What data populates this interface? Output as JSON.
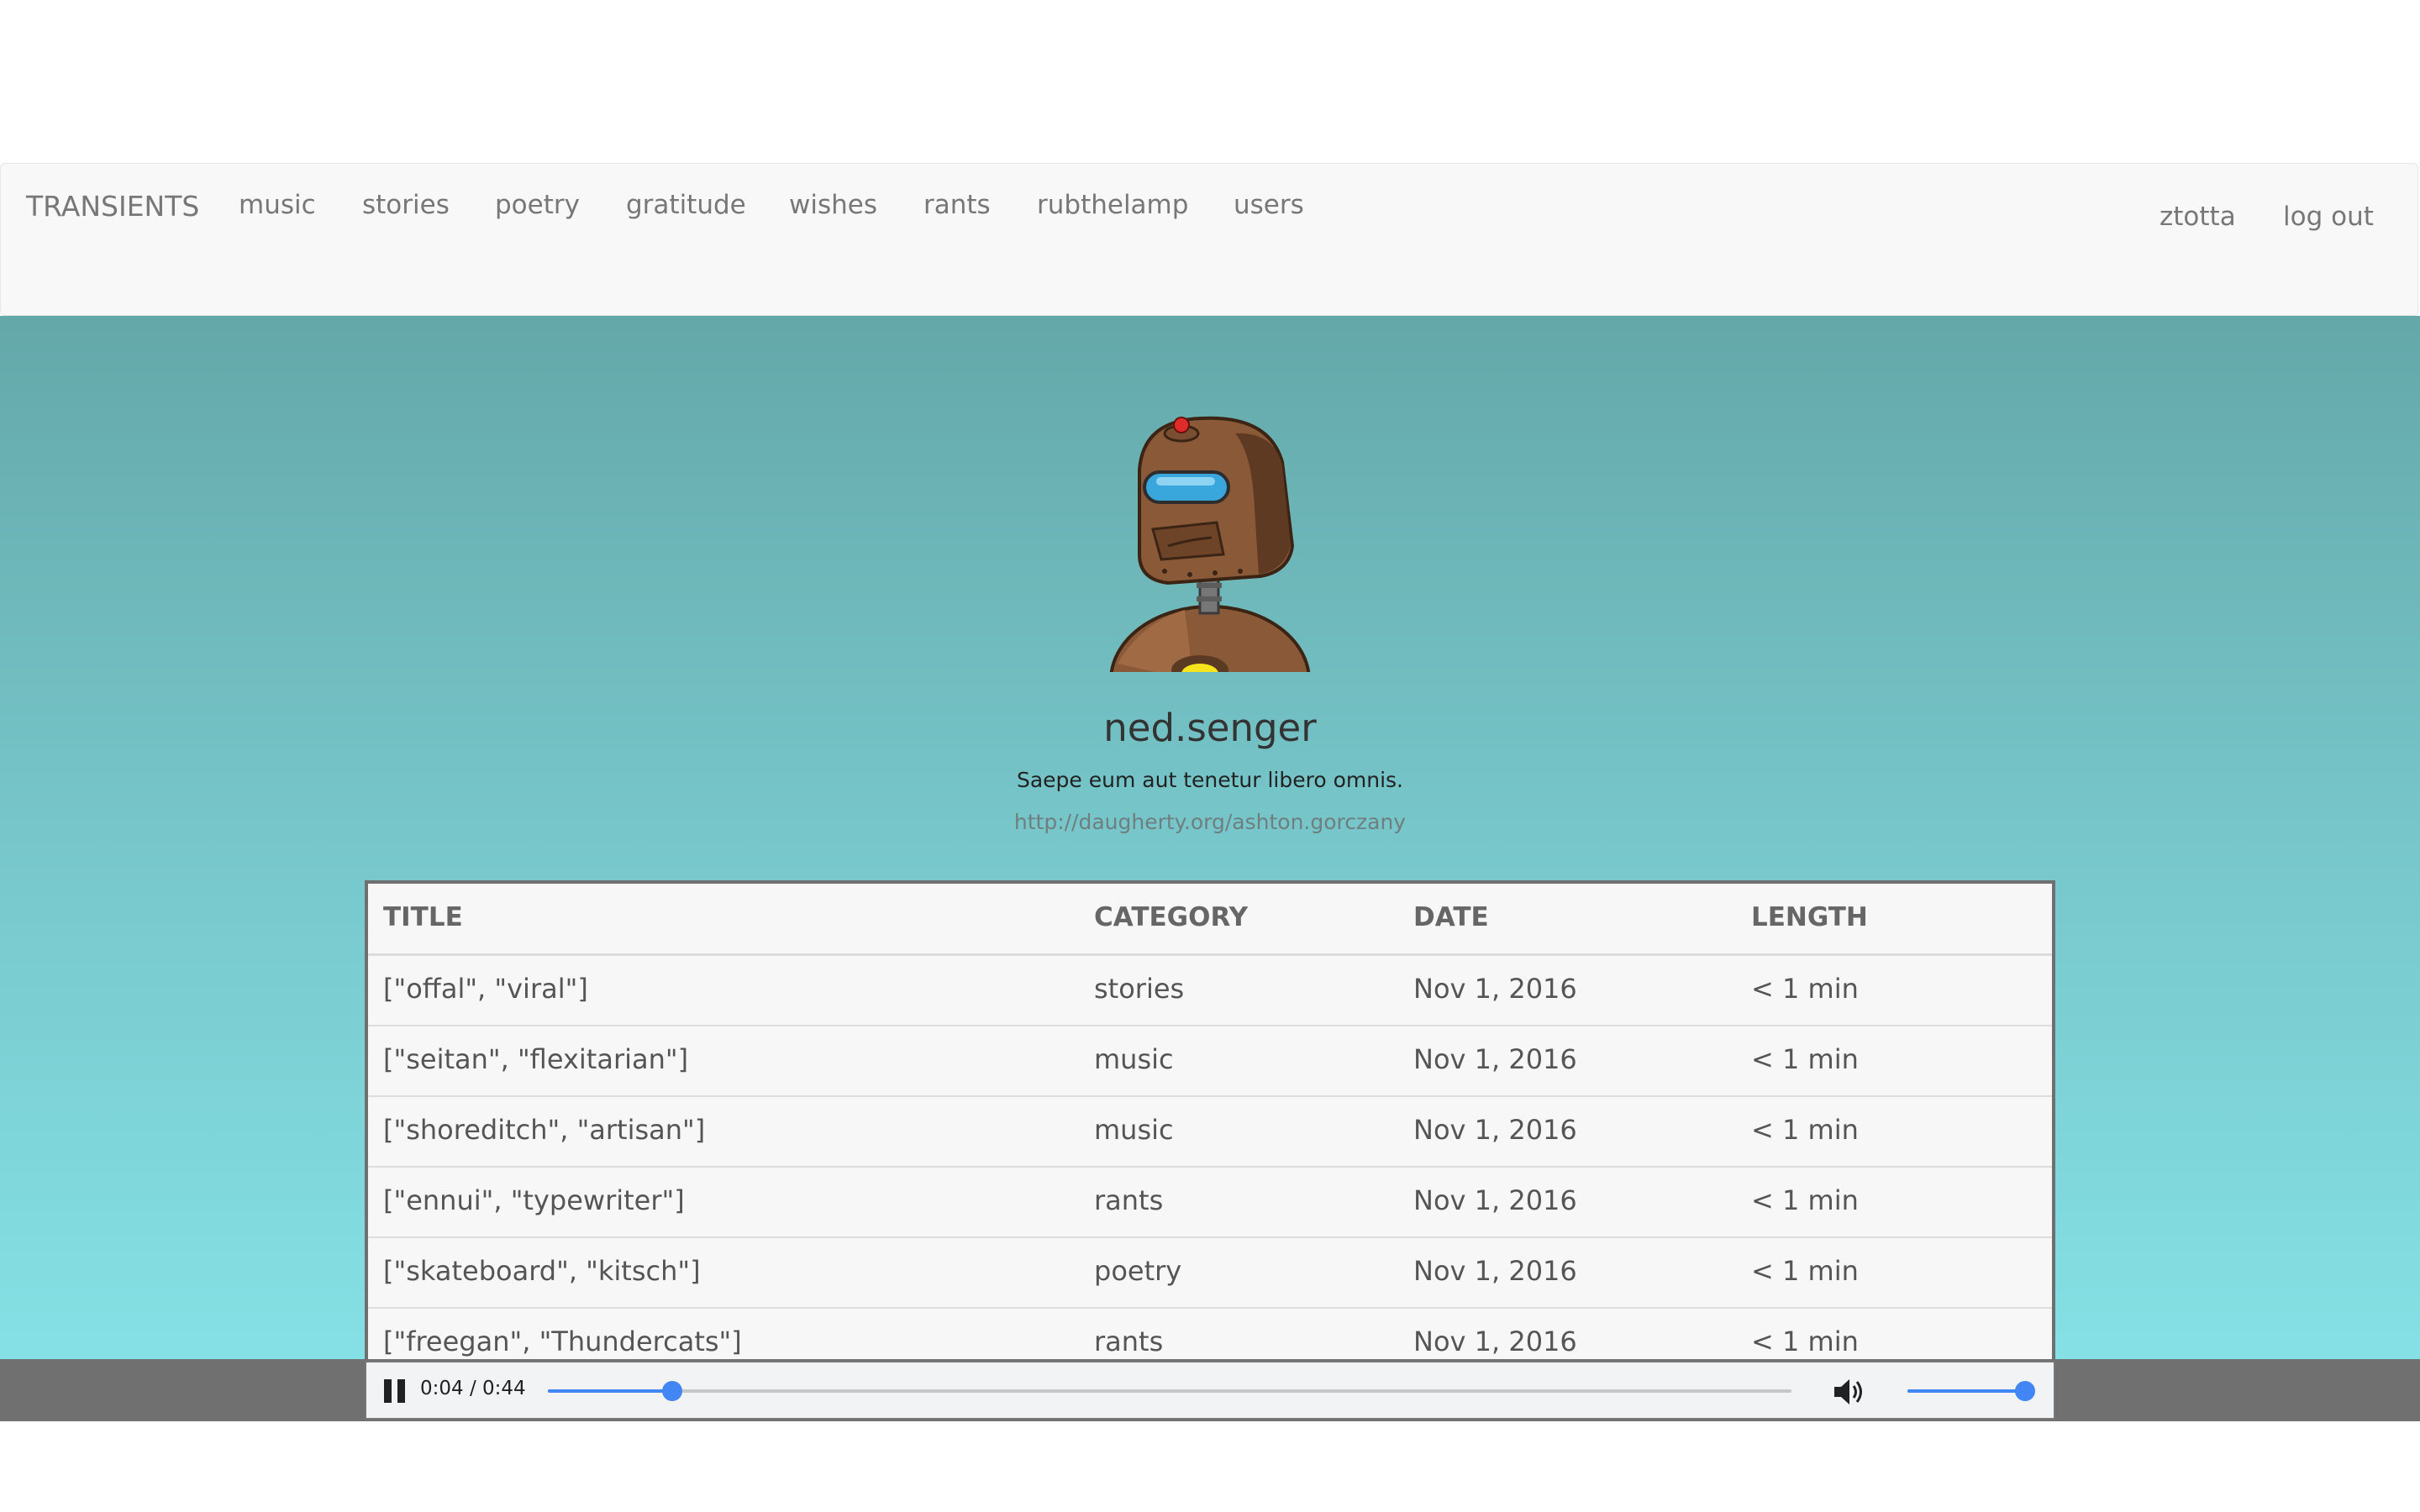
{
  "nav": {
    "brand": "TRANSIENTS",
    "links": [
      "music",
      "stories",
      "poetry",
      "gratitude",
      "wishes",
      "rants",
      "rubthelamp",
      "users"
    ],
    "user": "ztotta",
    "logout": "log out"
  },
  "profile": {
    "username": "ned.senger",
    "tagline": "Saepe eum aut tenetur libero omnis.",
    "website": "http://daugherty.org/ashton.gorczany",
    "avatar_icon": "robot-avatar-icon"
  },
  "table": {
    "headers": [
      "TITLE",
      "CATEGORY",
      "DATE",
      "LENGTH"
    ],
    "rows": [
      [
        "[\"offal\", \"viral\"]",
        "stories",
        "Nov 1, 2016",
        "< 1 min"
      ],
      [
        "[\"seitan\", \"flexitarian\"]",
        "music",
        "Nov 1, 2016",
        "< 1 min"
      ],
      [
        "[\"shoreditch\", \"artisan\"]",
        "music",
        "Nov 1, 2016",
        "< 1 min"
      ],
      [
        "[\"ennui\", \"typewriter\"]",
        "rants",
        "Nov 1, 2016",
        "< 1 min"
      ],
      [
        "[\"skateboard\", \"kitsch\"]",
        "poetry",
        "Nov 1, 2016",
        "< 1 min"
      ],
      [
        "[\"freegan\", \"Thundercats\"]",
        "rants",
        "Nov 1, 2016",
        "< 1 min"
      ]
    ]
  },
  "player": {
    "time": "0:04 / 0:44",
    "progress": 0.1,
    "volume": 1.0,
    "play_icon": "pause-icon",
    "volume_icon": "volume-icon",
    "accent_color": "#4285f4"
  }
}
